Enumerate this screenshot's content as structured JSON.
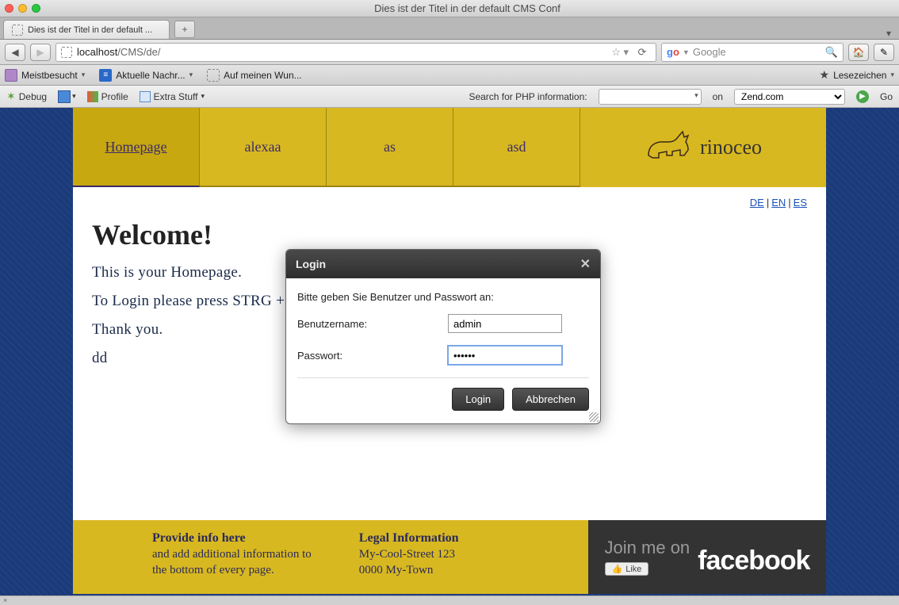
{
  "window": {
    "title": "Dies ist der Titel in der default CMS Conf"
  },
  "tab": {
    "title": "Dies ist der Titel in der default ...",
    "new_tab_symbol": "+"
  },
  "url": {
    "host": "localhost",
    "path": "/CMS/de/"
  },
  "search": {
    "engine_label": "Google"
  },
  "bookmarks_bar": {
    "meist": "Meistbesucht",
    "aktuelle": "Aktuelle Nachr...",
    "wunsch": "Auf meinen Wun...",
    "lesezeichen": "Lesezeichen"
  },
  "devbar": {
    "debug": "Debug",
    "profile": "Profile",
    "extra": "Extra Stuff",
    "search_label": "Search for PHP information:",
    "on_label": "on",
    "site_selected": "Zend.com",
    "go": "Go"
  },
  "nav": {
    "items": [
      {
        "label": "Homepage",
        "active": true
      },
      {
        "label": "alexaa",
        "active": false
      },
      {
        "label": "as",
        "active": false
      },
      {
        "label": "asd",
        "active": false
      }
    ],
    "brand": "rinoceo"
  },
  "lang": {
    "de": "DE",
    "en": "EN",
    "es": "ES"
  },
  "content": {
    "welcome": "Welcome!",
    "p1": "This is your Homepage.",
    "p2": "To Login please press STRG + S",
    "p3": "Thank you.",
    "p4": "dd"
  },
  "footer": {
    "col1_title": "Provide info here",
    "col1_l1": "and add additional information to",
    "col1_l2": "the bottom of every page.",
    "col2_title": "Legal Information",
    "col2_l1": "My-Cool-Street 123",
    "col2_l2": "0000 My-Town",
    "fb_line1": "Join me on",
    "fb_word": "facebook",
    "fb_like": "Like"
  },
  "dialog": {
    "title": "Login",
    "prompt": "Bitte geben Sie Benutzer und Passwort an:",
    "username_label": "Benutzername:",
    "username_value": "admin",
    "password_label": "Passwort:",
    "password_value": "••••••",
    "login_btn": "Login",
    "cancel_btn": "Abbrechen"
  },
  "statusbar": {
    "text": "×"
  }
}
